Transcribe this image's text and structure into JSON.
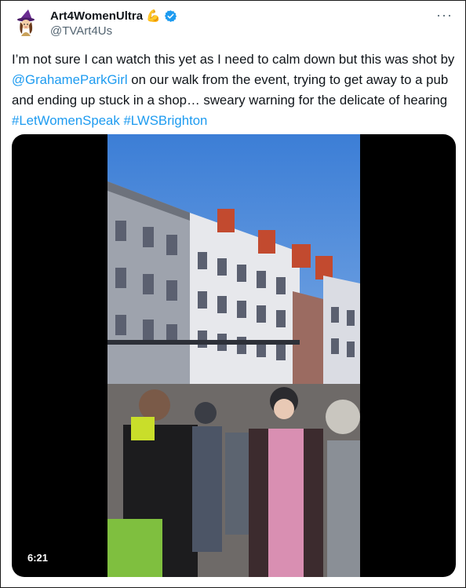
{
  "tweet": {
    "display_name": "Art4WomenUltra",
    "name_emoji": "💪",
    "handle": "@TVArt4Us",
    "more_label": "···",
    "text_1": "I’m not sure I can watch this yet as I need to calm down but this was shot by ",
    "mention": "@GrahameParkGirl",
    "text_2": " on our walk from the event, trying to get away to a pub and ending up stuck in a shop… sweary warning for the delicate of hearing ",
    "hashtag_1": "#LetWomenSpeak",
    "hashtag_2": "#LWSBrighton"
  },
  "media": {
    "duration": "6:21"
  },
  "colors": {
    "link": "#1d9bf0",
    "verified": "#1d9bf0",
    "text": "#0f1419",
    "secondary": "#536471"
  },
  "icons": {
    "avatar": "witch-avatar",
    "verified": "verified-badge-icon",
    "more": "more-options-icon"
  }
}
